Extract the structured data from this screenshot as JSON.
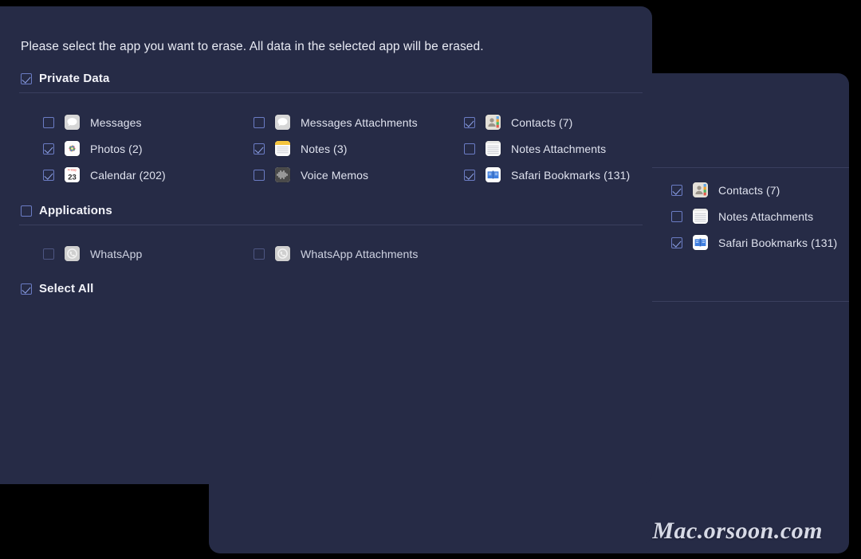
{
  "colors": {
    "panel_bg": "#262b46",
    "page_bg": "#000000",
    "divider": "#3a3f5e",
    "checkbox_border": "#6b7cc4",
    "checkbox_tick": "#8fa3e8",
    "text_primary": "#e9ebf4",
    "text_secondary": "#dfe2ee",
    "watermark": "#d7dae6"
  },
  "front_dialog": {
    "prompt": "Please select the app you want to erase. All data in the selected app will be erased.",
    "sections": [
      {
        "key": "private_data",
        "label": "Private Data",
        "checked": true,
        "checkbox_name": "private-data-checkbox",
        "items": [
          {
            "label": "Messages",
            "checked": false,
            "icon": "messages-icon",
            "disabled": false
          },
          {
            "label": "Photos (2)",
            "checked": true,
            "icon": "photos-icon",
            "disabled": false
          },
          {
            "label": "Calendar (202)",
            "checked": true,
            "icon": "calendar-icon",
            "disabled": false
          },
          {
            "label": "Messages Attachments",
            "checked": false,
            "icon": "messages-icon",
            "disabled": false
          },
          {
            "label": "Notes (3)",
            "checked": true,
            "icon": "notes-icon",
            "disabled": false
          },
          {
            "label": "Voice Memos",
            "checked": false,
            "icon": "voice-memos-icon",
            "disabled": false
          },
          {
            "label": "Contacts (7)",
            "checked": true,
            "icon": "contacts-icon",
            "disabled": false
          },
          {
            "label": "Notes Attachments",
            "checked": false,
            "icon": "notes-attachments-icon",
            "disabled": false
          },
          {
            "label": "Safari Bookmarks (131)",
            "checked": true,
            "icon": "safari-bookmarks-icon",
            "disabled": false
          }
        ]
      },
      {
        "key": "applications",
        "label": "Applications",
        "checked": false,
        "checkbox_name": "applications-checkbox",
        "items": [
          {
            "label": "WhatsApp",
            "checked": false,
            "icon": "whatsapp-icon",
            "disabled": true
          },
          {
            "label": "WhatsApp Attachments",
            "checked": false,
            "icon": "whatsapp-icon",
            "disabled": true
          }
        ]
      }
    ],
    "select_all": {
      "label": "Select All",
      "checked": true
    }
  },
  "back_dialog": {
    "prompt_visible_fragment": "app will be erased.",
    "items": [
      {
        "label": "Contacts (7)",
        "checked": true,
        "icon": "contacts-icon"
      },
      {
        "label": "Notes Attachments",
        "checked": false,
        "icon": "notes-attachments-icon"
      },
      {
        "label": "Safari Bookmarks (131)",
        "checked": true,
        "icon": "safari-bookmarks-icon"
      }
    ]
  },
  "watermark": {
    "text": "Mac.orsoon.com"
  }
}
